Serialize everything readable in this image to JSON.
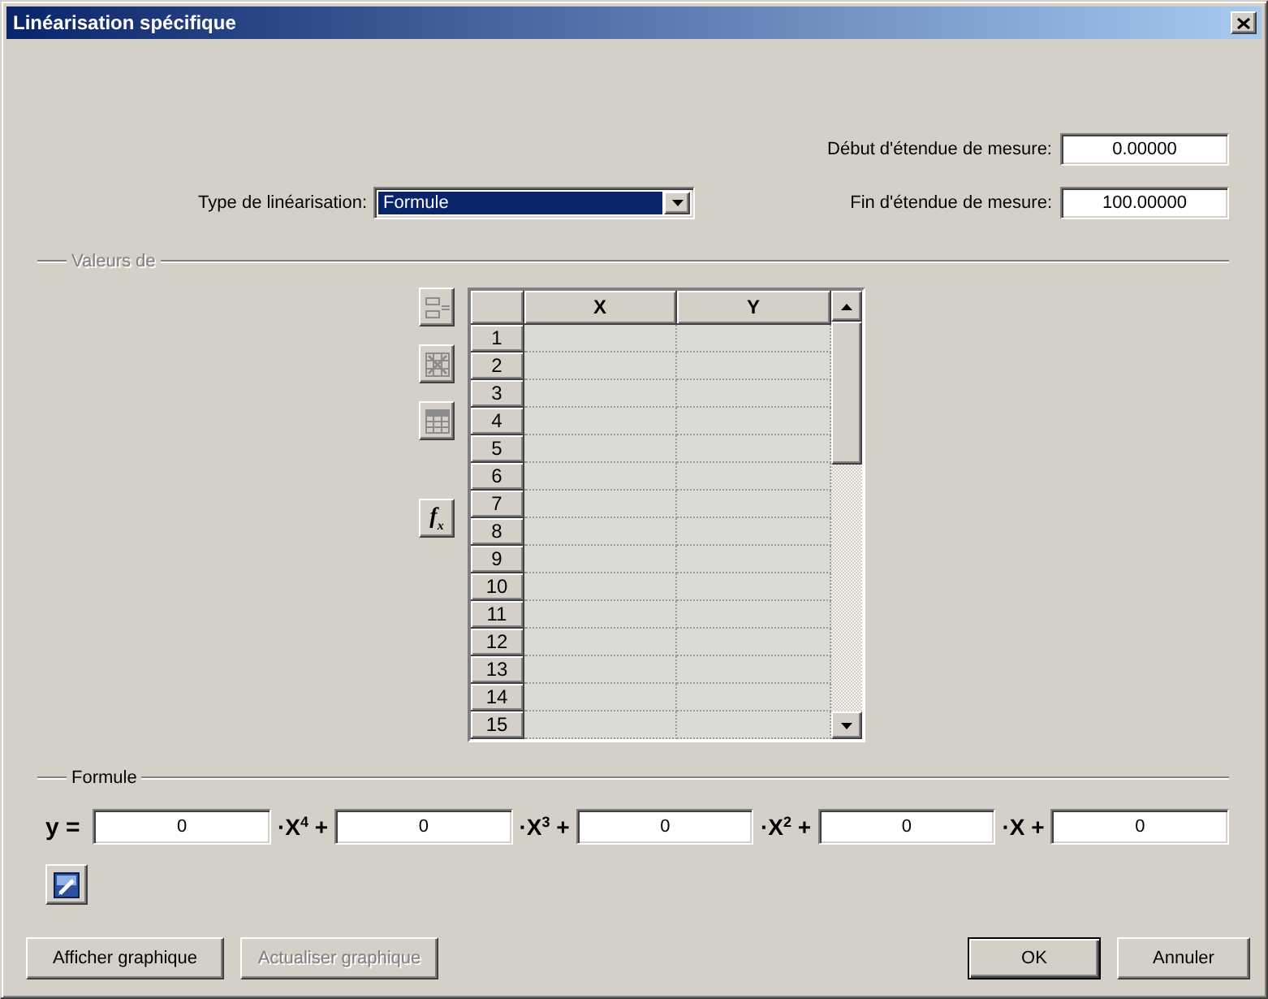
{
  "window": {
    "title": "Linéarisation spécifique"
  },
  "range": [
    {
      "label": "Début d'étendue de mesure:",
      "value": "0.00000"
    },
    {
      "label": "Fin d'étendue de mesure:",
      "value": "100.00000"
    }
  ],
  "linearization": {
    "label": "Type de linéarisation:",
    "value": "Formule",
    "highlighted": true
  },
  "values_group": {
    "label": "Valeurs de",
    "disabled": true,
    "tool_groups": [
      {
        "tools": [
          {
            "kind": "insert",
            "disabled": true
          },
          {
            "kind": "delete",
            "disabled": true
          },
          {
            "kind": "table",
            "disabled": true
          }
        ]
      },
      {
        "tools": [
          {
            "kind": "formula",
            "label": "f$_{x}$",
            "disabled": false
          }
        ]
      }
    ],
    "table": {
      "columns": [
        "X",
        "Y"
      ],
      "rows": [
        "1",
        "2",
        "3",
        "4",
        "5",
        "6",
        "7",
        "8",
        "9",
        "10",
        "11",
        "12",
        "13",
        "14",
        "15"
      ]
    }
  },
  "formula_group": {
    "label": "Formule",
    "lead": "y =",
    "terms": [
      {
        "value": "0",
        "suffix": "·X$^{4}$ +"
      },
      {
        "value": "0",
        "suffix": "·X$^{3}$ +"
      },
      {
        "value": "0",
        "suffix": "·X$^{2}$ +"
      },
      {
        "value": "0",
        "suffix": "·X +"
      },
      {
        "value": "0"
      }
    ]
  },
  "actions": {
    "left": [
      {
        "label": "Afficher graphique",
        "disabled": false,
        "default": false
      },
      {
        "label": "Actualiser graphique",
        "disabled": true,
        "default": false
      }
    ],
    "right": [
      {
        "label": "OK",
        "disabled": false,
        "default": true
      },
      {
        "label": "Annuler",
        "disabled": false,
        "default": false
      }
    ]
  }
}
